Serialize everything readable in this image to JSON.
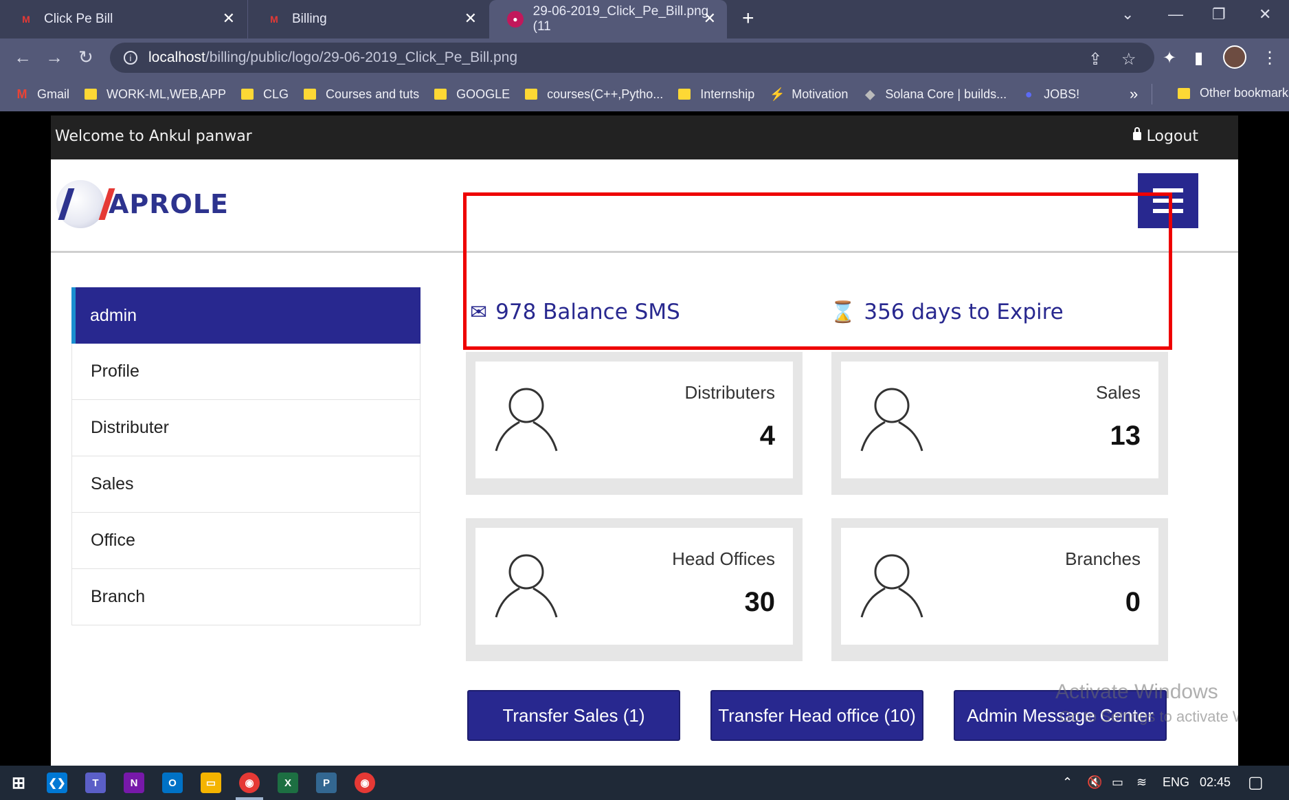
{
  "browser": {
    "tabs": [
      {
        "title": "Click Pe Bill",
        "favicon": "brand-logo-icon"
      },
      {
        "title": "Billing",
        "favicon": "brand-logo-icon"
      },
      {
        "title": "29-06-2019_Click_Pe_Bill.png (11",
        "favicon": "image-icon"
      }
    ],
    "url_host": "localhost",
    "url_path": "/billing/public/logo/29-06-2019_Click_Pe_Bill.png",
    "bookmarks": [
      {
        "label": "Gmail",
        "icon": "gmail-icon"
      },
      {
        "label": "WORK-ML,WEB,APP",
        "icon": "folder-icon"
      },
      {
        "label": "CLG",
        "icon": "folder-icon"
      },
      {
        "label": "Courses and tuts",
        "icon": "folder-icon"
      },
      {
        "label": "GOOGLE",
        "icon": "folder-icon"
      },
      {
        "label": "courses(C++,Pytho...",
        "icon": "folder-icon"
      },
      {
        "label": "Internship",
        "icon": "folder-icon"
      },
      {
        "label": "Motivation",
        "icon": "motivation-icon"
      },
      {
        "label": "Solana Core | builds...",
        "icon": "solana-icon"
      },
      {
        "label": "JOBS!",
        "icon": "jobs-icon"
      }
    ],
    "bookmarks_more": "»",
    "other_bookmarks": "Other bookmarks"
  },
  "app": {
    "welcome": "Welcome to Ankul panwar",
    "logout": "Logout",
    "logo_text": "APROLE",
    "sidebar": [
      {
        "label": "admin",
        "active": true
      },
      {
        "label": "Profile"
      },
      {
        "label": "Distributer"
      },
      {
        "label": "Sales"
      },
      {
        "label": "Office"
      },
      {
        "label": "Branch"
      }
    ],
    "stats": {
      "sms": "978 Balance SMS",
      "expire": "356 days to Expire"
    },
    "cards": [
      {
        "label": "Distributers",
        "count": "4"
      },
      {
        "label": "Sales",
        "count": "13"
      },
      {
        "label": "Head Offices",
        "count": "30"
      },
      {
        "label": "Branches",
        "count": "0"
      }
    ],
    "buttons": {
      "transfer_sales": "Transfer Sales (1)",
      "transfer_head_office": "Transfer Head office (10)",
      "admin_message_center": "Admin Message Center"
    },
    "accent_color": "#28288f",
    "highlight_color": "#ee0000"
  },
  "watermark": {
    "line1": "Activate Windows",
    "line2": "Go to Settings to activate Windows."
  },
  "taskbar": {
    "language": "ENG",
    "time": "02:45"
  }
}
